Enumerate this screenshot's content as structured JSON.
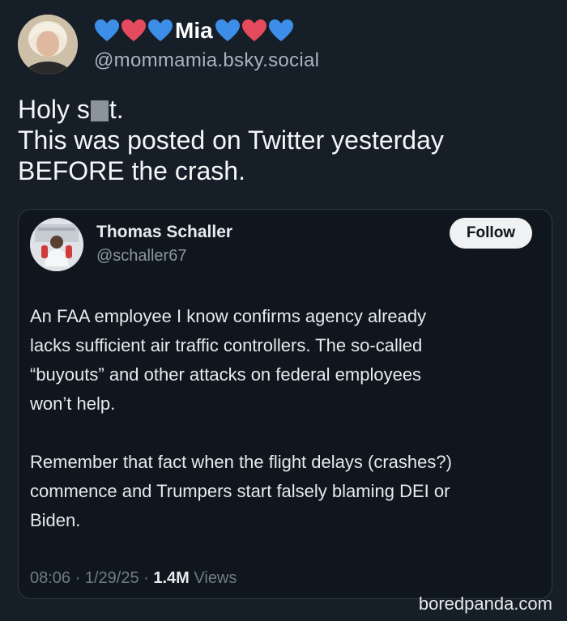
{
  "post": {
    "author": {
      "display_name": "Mia",
      "handle": "@mommamia.bsky.social",
      "heart_colors": [
        "#3d8ee8",
        "#e64a5f",
        "#3d8ee8"
      ]
    },
    "text": {
      "line1_a": "Holy s",
      "line1_b": "t.",
      "line2": "This was posted on Twitter yesterday",
      "line3": "BEFORE the crash."
    },
    "quote": {
      "name": "Thomas Schaller",
      "handle": "@schaller67",
      "follow_label": "Follow",
      "para1": [
        "An FAA employee I know confirms agency already",
        "lacks sufficient air traffic controllers. The so-called",
        "“buyouts” and other attacks on federal employees",
        "won’t help."
      ],
      "para2": [
        "Remember that fact when the flight delays (crashes?)",
        "commence and Trumpers start falsely blaming DEI or",
        "Biden."
      ],
      "time": "08:06",
      "date": "1/29/25",
      "views_count": "1.4M",
      "views_label": "Views"
    }
  },
  "watermark": "boredpanda.com"
}
